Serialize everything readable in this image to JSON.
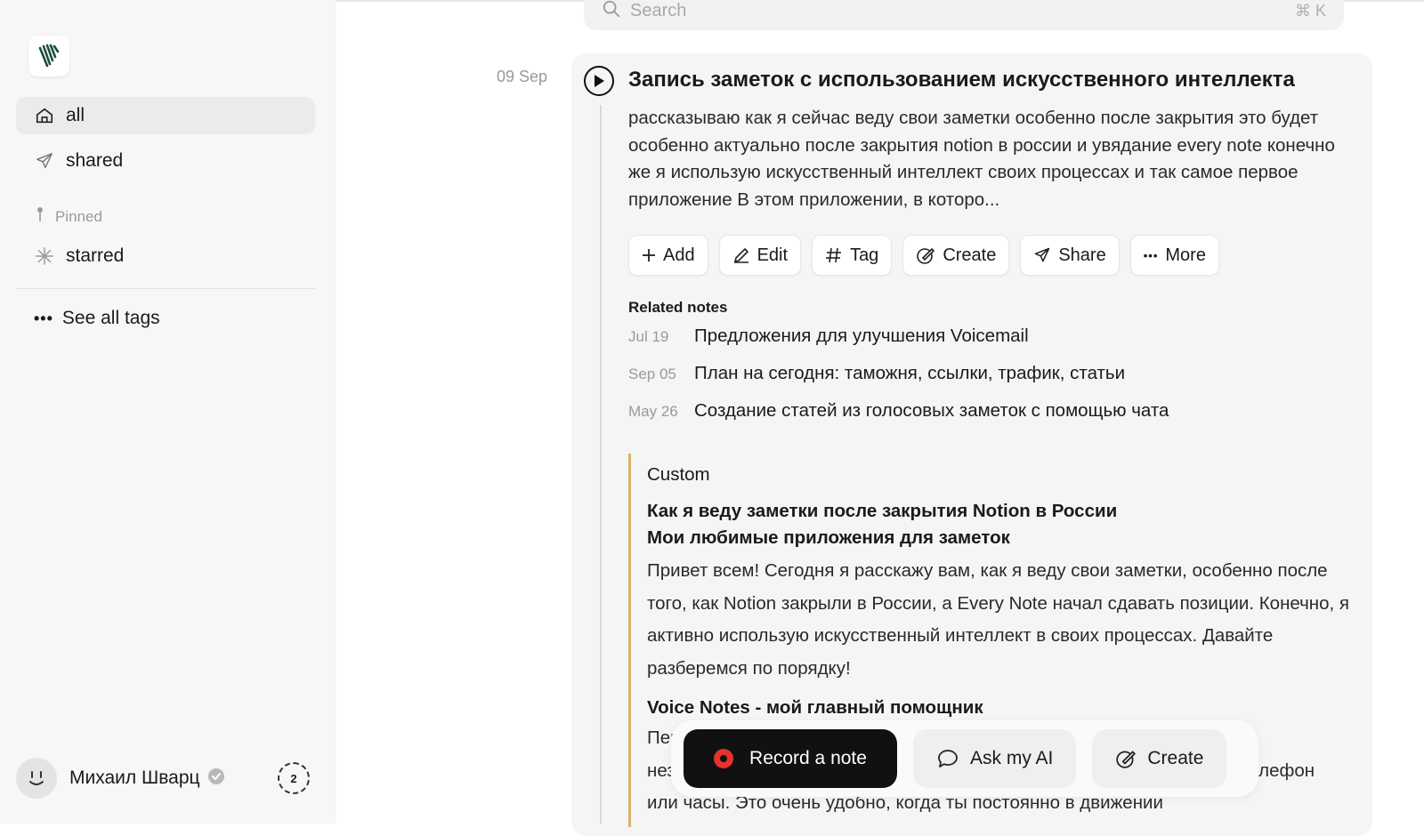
{
  "sidebar": {
    "nav": [
      {
        "label": "all",
        "icon": "home-icon",
        "active": true
      },
      {
        "label": "shared",
        "icon": "paper-plane-icon"
      }
    ],
    "pinned_label": "Pinned",
    "pinned_items": [
      {
        "label": "starred",
        "icon": "asterisk-icon"
      }
    ],
    "see_all_tags": "See all tags",
    "user": {
      "name": "Михаил Шварц",
      "counter": "2"
    }
  },
  "search": {
    "placeholder": "Search",
    "shortcut": "⌘ K"
  },
  "note": {
    "date": "09 Sep",
    "title": "Запись заметок с использованием искусственного интеллекта",
    "summary": "рассказываю как я сейчас веду свои заметки особенно после закрытия это будет особенно актуально после закрытия notion в россии и увядание every note конечно же я использую искусственный интеллект своих процессах и так самое первое приложение В этом приложении, в которо...",
    "actions": [
      "Add",
      "Edit",
      "Tag",
      "Create",
      "Share",
      "More"
    ],
    "related_heading": "Related notes",
    "related": [
      {
        "date": "Jul 19",
        "title": "Предложения для улучшения Voicemail"
      },
      {
        "date": "Sep 05",
        "title": "План на сегодня: таможня, ссылки, трафик, статьи"
      },
      {
        "date": "May 26",
        "title": "Создание статей из голосовых заметок с помощью чата"
      }
    ],
    "custom": {
      "label": "Custom",
      "heading1": "Как я веду заметки после закрытия Notion в России",
      "heading2": "Мои любимые приложения для заметок",
      "para1": "Привет всем! Сегодня я расскажу вам, как я веду свои заметки, особенно после того, как Notion закрыли в России, а Every Note начал сдавать позиции. Конечно, я активно использую искусственный интеллект в своих процессах. Давайте разберемся по порядку!",
      "heading3": "Voice Notes - мой главный помощник",
      "para2": "Первым делом хочу рассказать о приложении Voice Notes. Оно просто незаменимо, когда нужно быстро записать мысли, проговаривая их в телефон или часы. Это очень удобно, когда ты постоянно в движении"
    }
  },
  "floatbar": {
    "record": "Record a note",
    "ask": "Ask my AI",
    "create": "Create"
  },
  "colors": {
    "accent_line": "#d6b46a",
    "record_dot": "#e5322d",
    "logo": "#1f4d3c"
  }
}
